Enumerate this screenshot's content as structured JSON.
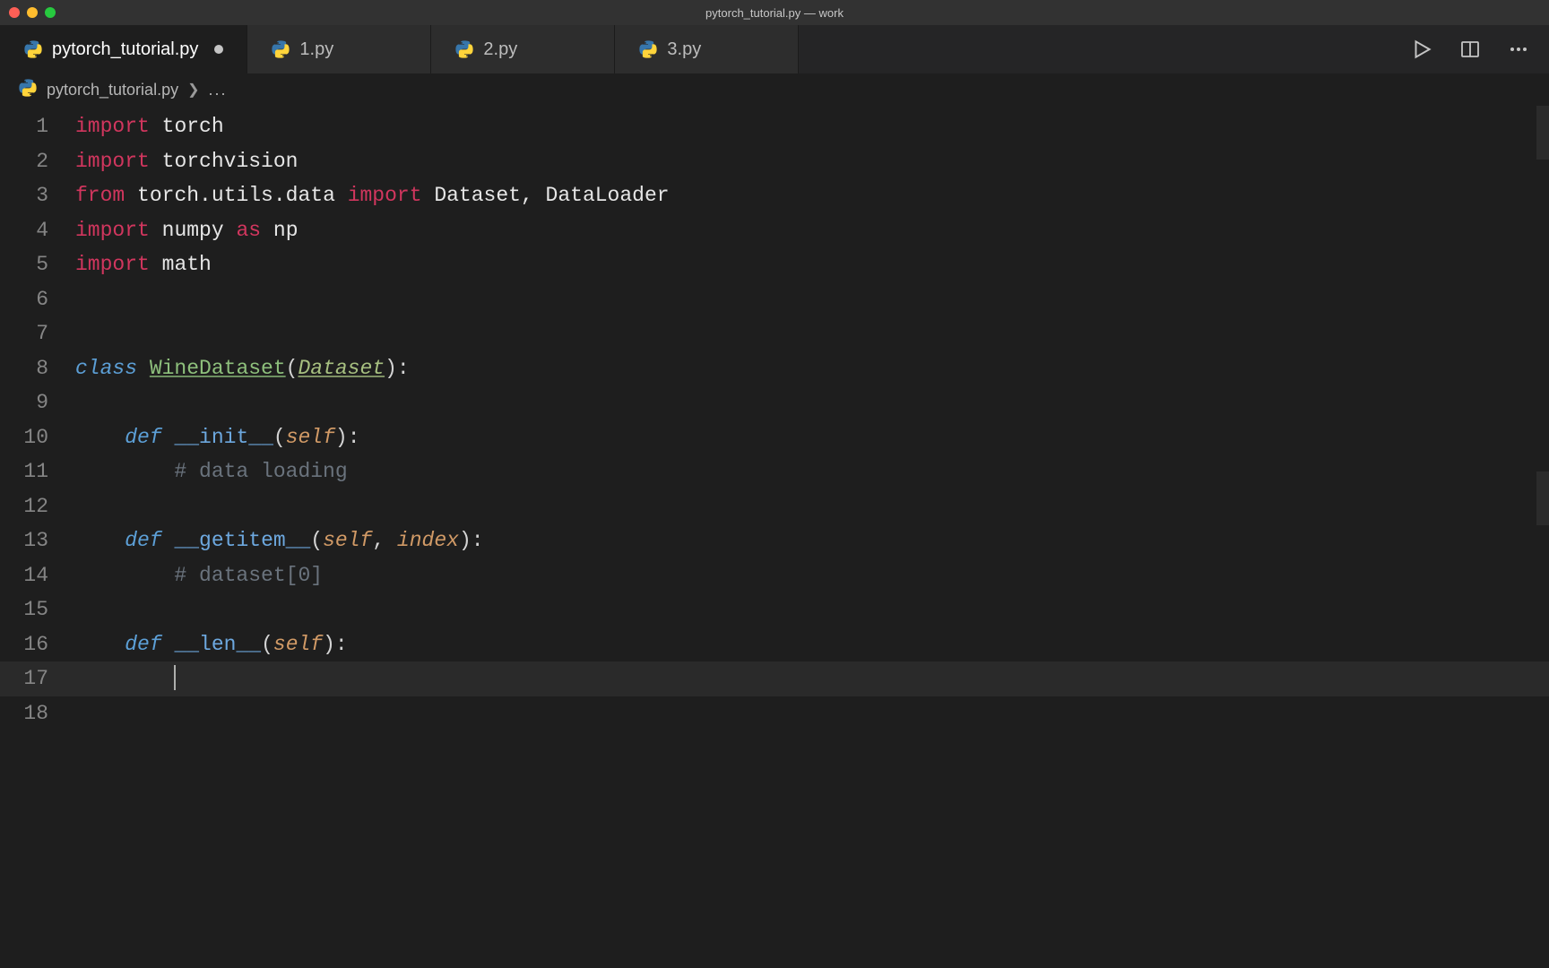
{
  "window": {
    "title": "pytorch_tutorial.py — work"
  },
  "tabs": [
    {
      "label": "pytorch_tutorial.py",
      "active": true,
      "modified": true
    },
    {
      "label": "1.py",
      "active": false,
      "modified": false
    },
    {
      "label": "2.py",
      "active": false,
      "modified": false
    },
    {
      "label": "3.py",
      "active": false,
      "modified": false
    }
  ],
  "breadcrumb": {
    "file": "pytorch_tutorial.py",
    "ellipsis": "..."
  },
  "icons": {
    "python": "python-icon",
    "run": "play-icon",
    "split": "split-editor-icon",
    "more": "more-icon"
  },
  "code": {
    "lines": [
      {
        "n": 1,
        "tokens": [
          {
            "t": "import",
            "c": "kw"
          },
          {
            "t": " "
          },
          {
            "t": "torch",
            "c": "ident"
          }
        ]
      },
      {
        "n": 2,
        "tokens": [
          {
            "t": "import",
            "c": "kw"
          },
          {
            "t": " "
          },
          {
            "t": "torchvision",
            "c": "ident"
          }
        ]
      },
      {
        "n": 3,
        "tokens": [
          {
            "t": "from",
            "c": "kw"
          },
          {
            "t": " "
          },
          {
            "t": "torch.utils.data",
            "c": "ident"
          },
          {
            "t": " "
          },
          {
            "t": "import",
            "c": "kw"
          },
          {
            "t": " "
          },
          {
            "t": "Dataset, DataLoader",
            "c": "ident"
          }
        ]
      },
      {
        "n": 4,
        "tokens": [
          {
            "t": "import",
            "c": "kw"
          },
          {
            "t": " "
          },
          {
            "t": "numpy",
            "c": "ident"
          },
          {
            "t": " "
          },
          {
            "t": "as",
            "c": "kw"
          },
          {
            "t": " "
          },
          {
            "t": "np",
            "c": "ident"
          }
        ]
      },
      {
        "n": 5,
        "tokens": [
          {
            "t": "import",
            "c": "kw"
          },
          {
            "t": " "
          },
          {
            "t": "math",
            "c": "ident"
          }
        ]
      },
      {
        "n": 6,
        "tokens": []
      },
      {
        "n": 7,
        "tokens": []
      },
      {
        "n": 8,
        "tokens": [
          {
            "t": "class",
            "c": "kw-i"
          },
          {
            "t": " "
          },
          {
            "t": "WineDataset",
            "c": "cls"
          },
          {
            "t": "(",
            "c": "punct"
          },
          {
            "t": "Dataset",
            "c": "cls2"
          },
          {
            "t": "):",
            "c": "punct"
          }
        ]
      },
      {
        "n": 9,
        "indent": 1,
        "tokens": []
      },
      {
        "n": 10,
        "indent": 1,
        "tokens": [
          {
            "t": "    "
          },
          {
            "t": "def",
            "c": "kw-i"
          },
          {
            "t": " "
          },
          {
            "t": "__init__",
            "c": "dunder"
          },
          {
            "t": "(",
            "c": "punct"
          },
          {
            "t": "self",
            "c": "param"
          },
          {
            "t": "):",
            "c": "punct"
          }
        ]
      },
      {
        "n": 11,
        "indent": 2,
        "tokens": [
          {
            "t": "        "
          },
          {
            "t": "# data loading",
            "c": "comment"
          }
        ]
      },
      {
        "n": 12,
        "indent": 1,
        "tokens": []
      },
      {
        "n": 13,
        "indent": 1,
        "tokens": [
          {
            "t": "    "
          },
          {
            "t": "def",
            "c": "kw-i"
          },
          {
            "t": " "
          },
          {
            "t": "__getitem__",
            "c": "dunder"
          },
          {
            "t": "(",
            "c": "punct"
          },
          {
            "t": "self",
            "c": "param"
          },
          {
            "t": ", ",
            "c": "punct"
          },
          {
            "t": "index",
            "c": "param"
          },
          {
            "t": "):",
            "c": "punct"
          }
        ]
      },
      {
        "n": 14,
        "indent": 2,
        "tokens": [
          {
            "t": "        "
          },
          {
            "t": "# dataset[0]",
            "c": "comment"
          }
        ]
      },
      {
        "n": 15,
        "indent": 1,
        "tokens": []
      },
      {
        "n": 16,
        "indent": 1,
        "tokens": [
          {
            "t": "    "
          },
          {
            "t": "def",
            "c": "kw-i"
          },
          {
            "t": " "
          },
          {
            "t": "__len__",
            "c": "dunder"
          },
          {
            "t": "(",
            "c": "punct"
          },
          {
            "t": "self",
            "c": "param"
          },
          {
            "t": "):",
            "c": "punct"
          }
        ]
      },
      {
        "n": 17,
        "indent": 2,
        "highlight": true,
        "cursor": true,
        "tokens": [
          {
            "t": "        "
          }
        ]
      },
      {
        "n": 18,
        "tokens": []
      }
    ]
  }
}
